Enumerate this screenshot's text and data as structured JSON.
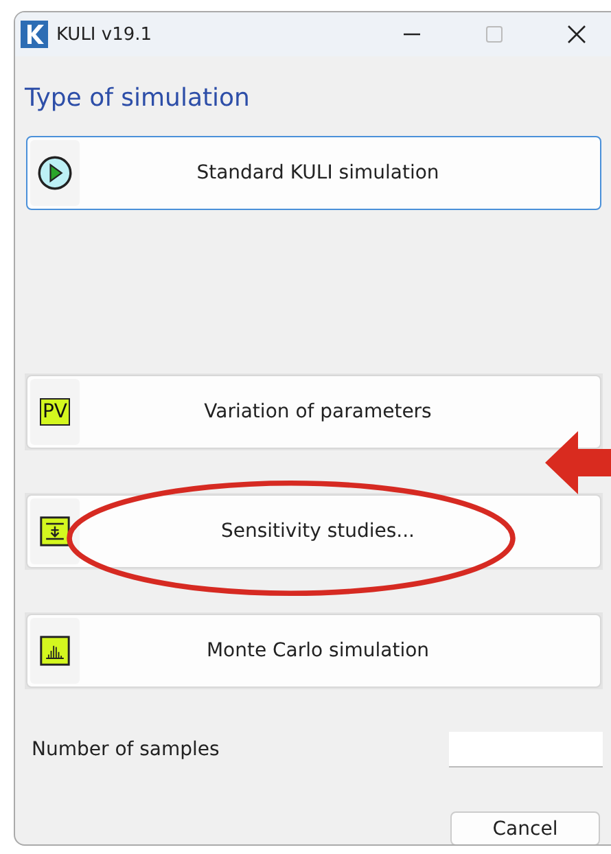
{
  "window": {
    "title": "KULI v19.1"
  },
  "heading": "Type of simulation",
  "options": [
    {
      "kind": "play",
      "label": "Standard KULI simulation",
      "focused": true
    },
    {
      "kind": "pv",
      "label": "Variation of parameters",
      "focused": false,
      "icon_text": "PV"
    },
    {
      "kind": "sensitivity",
      "label": "Sensitivity studies...",
      "focused": false
    },
    {
      "kind": "histogram",
      "label": "Monte Carlo simulation",
      "focused": false
    }
  ],
  "samples": {
    "label": "Number of samples"
  },
  "buttons": [
    "Cancel"
  ]
}
